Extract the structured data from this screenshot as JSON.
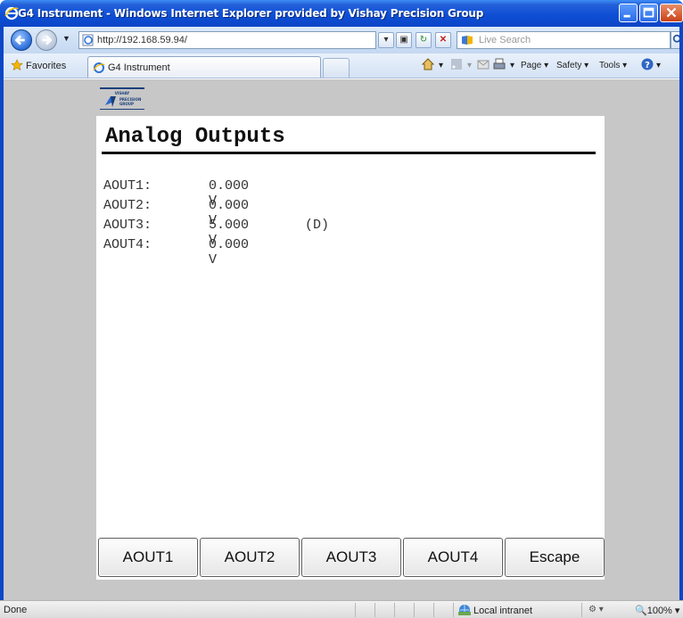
{
  "window": {
    "title": "G4 Instrument - Windows Internet Explorer provided by Vishay Precision Group"
  },
  "addressbar": {
    "url": "http://192.168.59.94/",
    "search_placeholder": "Live Search"
  },
  "favbar": {
    "favorites_label": "Favorites",
    "tab_label": "G4 Instrument",
    "commands": [
      "Page",
      "Safety",
      "Tools"
    ]
  },
  "page": {
    "logo_text": "VISHAY PRECISION GROUP",
    "title": "Analog Outputs",
    "outputs": [
      {
        "name": "AOUT1:",
        "value": "0.000 V",
        "flag": ""
      },
      {
        "name": "AOUT2:",
        "value": "0.000 V",
        "flag": ""
      },
      {
        "name": "AOUT3:",
        "value": "5.000 V",
        "flag": "(D)"
      },
      {
        "name": "AOUT4:",
        "value": "0.000 V",
        "flag": ""
      }
    ],
    "buttons": [
      "AOUT1",
      "AOUT2",
      "AOUT3",
      "AOUT4",
      "Escape"
    ]
  },
  "statusbar": {
    "status": "Done",
    "zone": "Local intranet",
    "zoom": "100%"
  },
  "colors": {
    "titlebar": "#0f4fd6",
    "content_background": "#c7c7c7",
    "panel": "#ffffff"
  }
}
